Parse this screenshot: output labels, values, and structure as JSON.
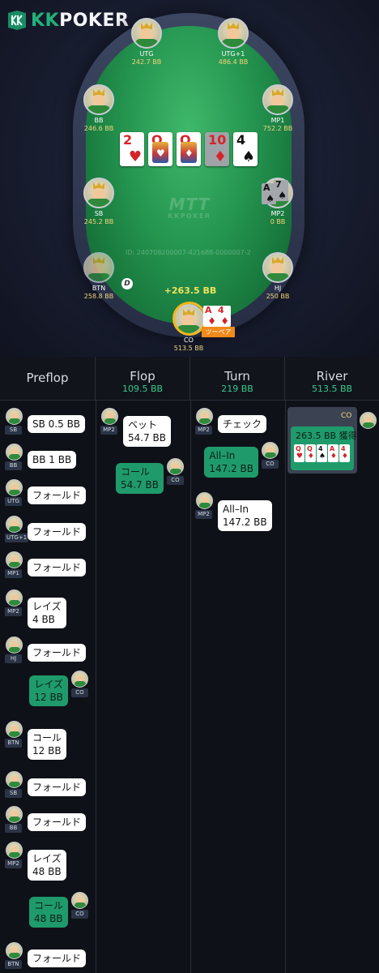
{
  "app": {
    "logo_text_a": "KK",
    "logo_text_b": "POKER"
  },
  "table": {
    "felt_mark": "MTT",
    "felt_sub": "KKPOKER",
    "hand_id": "ID: 240708200007-421688-0000007-2",
    "dealer": "D",
    "win_amount": "+263.5 BB",
    "hand_tag": "ツーペア",
    "seats": [
      {
        "name": "UTG",
        "stack": "242.7 BB"
      },
      {
        "name": "UTG+1",
        "stack": "486.4 BB"
      },
      {
        "name": "BB",
        "stack": "246.6 BB"
      },
      {
        "name": "MP1",
        "stack": "752.2 BB"
      },
      {
        "name": "SB",
        "stack": "245.2 BB"
      },
      {
        "name": "MP2",
        "stack": "0 BB"
      },
      {
        "name": "BTN",
        "stack": "258.8 BB"
      },
      {
        "name": "HJ",
        "stack": "250 BB"
      },
      {
        "name": "CO",
        "stack": "513.5 BB"
      }
    ],
    "board": [
      {
        "rank": "2",
        "suit": "♥",
        "color": "#d4242a"
      },
      {
        "rank": "Q",
        "suit": "♥",
        "color": "#d4242a"
      },
      {
        "rank": "Q",
        "suit": "♦",
        "color": "#d4242a"
      },
      {
        "rank": "10",
        "suit": "♦",
        "color": "#d4242a"
      },
      {
        "rank": "4",
        "suit": "♠",
        "color": "#111111"
      }
    ],
    "mp2_cards": [
      {
        "rank": "A",
        "suit": "♠"
      },
      {
        "rank": "7",
        "suit": "♠"
      }
    ],
    "hero_cards": [
      {
        "rank": "A",
        "suit": "♦"
      },
      {
        "rank": "4",
        "suit": "♦"
      }
    ]
  },
  "streets": [
    {
      "name": "Preflop",
      "pot": ""
    },
    {
      "name": "Flop",
      "pot": "109.5 BB"
    },
    {
      "name": "Turn",
      "pot": "219 BB"
    },
    {
      "name": "River",
      "pot": "513.5 BB"
    }
  ],
  "preflop": [
    {
      "pos": "SB",
      "line1": "SB 0.5 BB",
      "line2": ""
    },
    {
      "pos": "BB",
      "line1": "BB 1 BB",
      "line2": ""
    },
    {
      "pos": "UTG",
      "line1": "フォールド",
      "line2": ""
    },
    {
      "pos": "UTG+1",
      "line1": "フォールド",
      "line2": ""
    },
    {
      "pos": "MP1",
      "line1": "フォールド",
      "line2": ""
    },
    {
      "pos": "MP2",
      "line1": "レイズ",
      "line2": "4 BB"
    },
    {
      "pos": "HJ",
      "line1": "フォールド",
      "line2": ""
    },
    {
      "pos": "CO",
      "line1": "レイズ",
      "line2": "12 BB"
    },
    {
      "pos": "BTN",
      "line1": "コール",
      "line2": "12 BB"
    },
    {
      "pos": "SB",
      "line1": "フォールド",
      "line2": ""
    },
    {
      "pos": "BB",
      "line1": "フォールド",
      "line2": ""
    },
    {
      "pos": "MP2",
      "line1": "レイズ",
      "line2": "48 BB"
    },
    {
      "pos": "CO",
      "line1": "コール",
      "line2": "48 BB"
    },
    {
      "pos": "BTN",
      "line1": "フォールド",
      "line2": ""
    }
  ],
  "flop": [
    {
      "pos": "MP2",
      "line1": "ベット",
      "line2": "54.7 BB"
    },
    {
      "pos": "CO",
      "line1": "コール",
      "line2": "54.7 BB"
    }
  ],
  "turn": [
    {
      "pos": "MP2",
      "line1": "チェック",
      "line2": ""
    },
    {
      "pos": "CO",
      "line1": "All–In",
      "line2": "147.2 BB"
    },
    {
      "pos": "MP2",
      "line1": "All–In",
      "line2": "147.2 BB"
    }
  ],
  "river": {
    "pos": "CO",
    "result": "263.5 BB 獲得",
    "cards": [
      {
        "rank": "Q",
        "suit": "♥"
      },
      {
        "rank": "Q",
        "suit": "♦"
      },
      {
        "rank": "4",
        "suit": "♠"
      },
      {
        "rank": "A",
        "suit": "♦"
      },
      {
        "rank": "4",
        "suit": "♦"
      }
    ]
  },
  "colors": {
    "accent_green": "#1f9b6b",
    "pot_green": "#37c98a",
    "stack_gold": "#f3d57a",
    "win_yellow": "#f1e25d",
    "tag_orange": "#f08a1a"
  }
}
